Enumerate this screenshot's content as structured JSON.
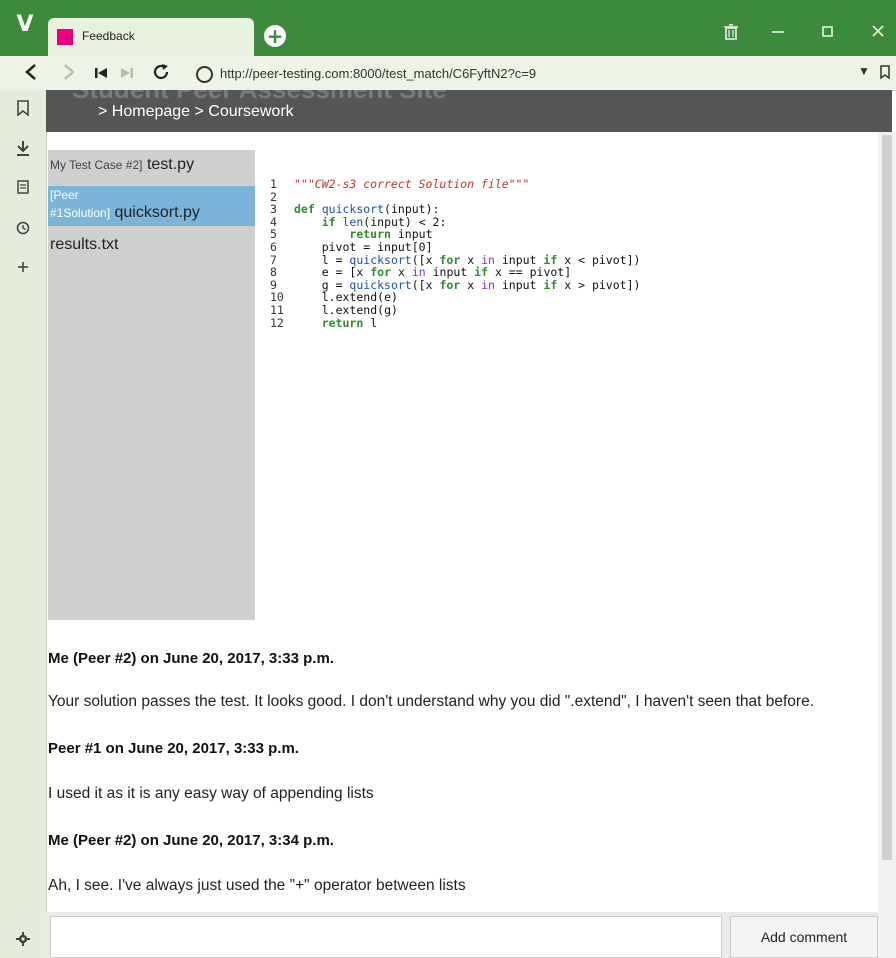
{
  "browser": {
    "logo_char": "V",
    "tab_title": "Feedback",
    "new_tab_char": "+",
    "url": "http://peer-testing.com:8000/test_match/C6FyftN2?c=9",
    "window_controls": [
      "trash-icon",
      "minimize-icon",
      "maximize-icon",
      "close-icon"
    ],
    "nav_icons": [
      "back-icon",
      "forward-icon",
      "rewind-icon",
      "fast-forward-icon",
      "reload-icon"
    ],
    "side_icons": [
      "bookmark-icon",
      "download-icon",
      "notes-icon",
      "history-icon",
      "add-panel-icon",
      "settings-icon"
    ],
    "accent_color": "#3c8a3c"
  },
  "page": {
    "header_ghost": "Student Peer Assessment Site",
    "breadcrumb": "> Homepage > Coursework"
  },
  "files": [
    {
      "tag": "My Test Case #2]",
      "name": "test.py",
      "selected": false
    },
    {
      "tag_line1": "[Peer",
      "tag_line2": "#1Solution]",
      "name": "quicksort.py",
      "selected": true
    },
    {
      "tag": "",
      "name": "results.txt",
      "selected": false
    }
  ],
  "code": {
    "line_numbers": [
      "1",
      "2",
      "3",
      "4",
      "5",
      "6",
      "7",
      "8",
      "9",
      "10",
      "11",
      "12"
    ],
    "lines": [
      "\"\"\"CW2-s3 correct Solution file\"\"\"",
      "",
      "def quicksort(input):",
      "    if len(input) < 2:",
      "        return input",
      "    pivot = input[0]",
      "    l = quicksort([x for x in input if x < pivot])",
      "    e = [x for x in input if x == pivot]",
      "    g = quicksort([x for x in input if x > pivot])",
      "    l.extend(e)",
      "    l.extend(g)",
      "    return l"
    ]
  },
  "comments": [
    {
      "author": "Me (Peer #2) on June 20, 2017, 3:33 p.m.",
      "body": "Your solution passes the test. It looks good. I don't understand why you did \".extend\", I haven't seen that before."
    },
    {
      "author": "Peer #1 on June 20, 2017, 3:33 p.m.",
      "body": "I used it as it is any easy way of appending lists"
    },
    {
      "author": "Me (Peer #2) on June 20, 2017, 3:34 p.m.",
      "body": "Ah, I see. I've always just used the \"+\" operator between lists"
    }
  ],
  "comment_form": {
    "input_value": "",
    "button_label": "Add comment"
  }
}
